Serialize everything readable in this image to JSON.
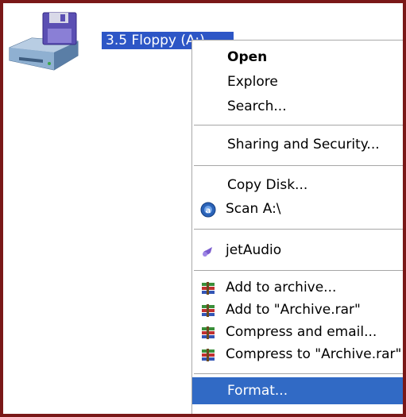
{
  "drive": {
    "label": "3.5 Floppy (A:)",
    "icon": "floppy-drive-icon"
  },
  "context_menu": {
    "items": [
      {
        "label": "Open",
        "bold": true
      },
      {
        "label": "Explore"
      },
      {
        "label": "Search..."
      },
      {
        "label": "Sharing and Security..."
      },
      {
        "label": "Copy Disk..."
      },
      {
        "label": "Scan A:\\",
        "icon": "antivirus-scan-icon"
      },
      {
        "label": "jetAudio",
        "icon": "jetaudio-icon"
      },
      {
        "label": "Add to archive...",
        "icon": "winrar-icon"
      },
      {
        "label": "Add to \"Archive.rar\"",
        "icon": "winrar-icon"
      },
      {
        "label": "Compress and email...",
        "icon": "winrar-icon"
      },
      {
        "label": "Compress to \"Archive.rar\" and email",
        "icon": "winrar-icon"
      },
      {
        "label": "Format...",
        "selected": true
      }
    ]
  },
  "colors": {
    "frame_border": "#7a1818",
    "selection": "#316ac5",
    "label_highlight": "#2d56c6"
  }
}
